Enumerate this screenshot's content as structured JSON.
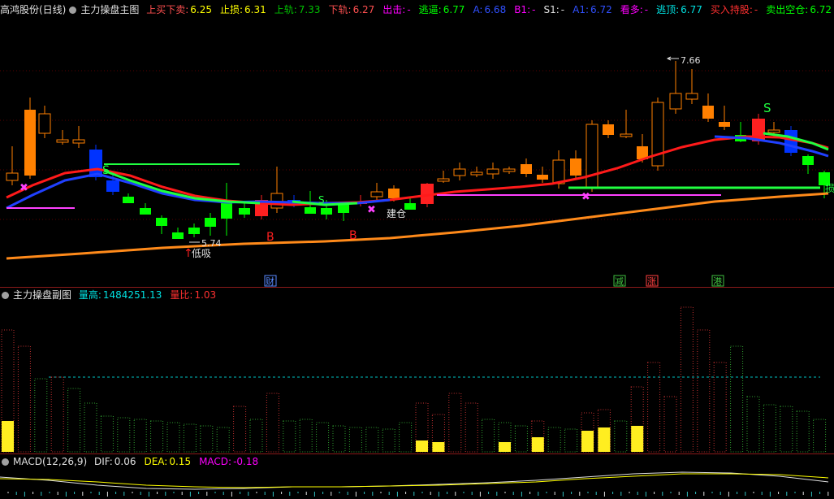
{
  "main": {
    "stock_title": "高鸿股份(日线)",
    "indicator_name": "主力操盘主图",
    "fields": [
      {
        "label": "上买下卖:",
        "value": "6.25",
        "lc": "#ff5050",
        "vc": "#ffff00"
      },
      {
        "label": "止损:",
        "value": "6.31",
        "lc": "#ffff00",
        "vc": "#ffff00"
      },
      {
        "label": "上轨:",
        "value": "7.33",
        "lc": "#00c000",
        "vc": "#00c000"
      },
      {
        "label": "下轨:",
        "value": "6.27",
        "lc": "#ff5050",
        "vc": "#ff5050"
      },
      {
        "label": "出击:",
        "value": "-",
        "lc": "#ff00ff",
        "vc": "#ff00ff"
      },
      {
        "label": "逃逼:",
        "value": "6.77",
        "lc": "#00ff00",
        "vc": "#00ff00"
      },
      {
        "label": "A:",
        "value": "6.68",
        "lc": "#3050ff",
        "vc": "#3050ff"
      },
      {
        "label": "B1:",
        "value": "-",
        "lc": "#ff00ff",
        "vc": "#ff00ff"
      },
      {
        "label": "S1:",
        "value": "-",
        "lc": "#e0e0e0",
        "vc": "#e0e0e0"
      },
      {
        "label": "A1:",
        "value": "6.72",
        "lc": "#3050ff",
        "vc": "#3050ff"
      },
      {
        "label": "看多:",
        "value": "-",
        "lc": "#ff00ff",
        "vc": "#ff00ff"
      },
      {
        "label": "逃顶:",
        "value": "6.77",
        "lc": "#00e0e0",
        "vc": "#00e0e0"
      },
      {
        "label": "买入持股:",
        "value": "-",
        "lc": "#ff3030",
        "vc": "#ff3030"
      },
      {
        "label": "卖出空仓:",
        "value": "6.72",
        "lc": "#00ff00",
        "vc": "#00ff00"
      }
    ],
    "annotations": {
      "high_price": "7.66",
      "low_price": "5.74",
      "low_buy": "低吸",
      "build_position": "建仓",
      "b_label": "B",
      "s_label": "S",
      "right_edge_label": "损"
    },
    "event_tags": [
      "财",
      "减",
      "涨",
      "港"
    ]
  },
  "sub": {
    "indicator_name": "主力操盘副图",
    "fields": [
      {
        "label": "量高:",
        "value": "1484251.13",
        "lc": "#00e0e0",
        "vc": "#00e0e0"
      },
      {
        "label": "量比:",
        "value": "1.03",
        "lc": "#ff3030",
        "vc": "#ff3030"
      }
    ]
  },
  "macd": {
    "indicator_name": "MACD(12,26,9)",
    "fields": [
      {
        "label": "DIF:",
        "value": "0.06",
        "lc": "#e0e0e0",
        "vc": "#e0e0e0"
      },
      {
        "label": "DEA:",
        "value": "0.15",
        "lc": "#ffff00",
        "vc": "#ffff00"
      },
      {
        "label": "MACD:",
        "value": "-0.18",
        "lc": "#ff00ff",
        "vc": "#ff00ff"
      }
    ]
  },
  "colors": {
    "background": "#000000",
    "separator": "#8b1a1a",
    "grid": "#5a0000",
    "up_candle": "#ff8000",
    "down_candle": "#00ff00",
    "blue_candle": "#0033ff",
    "red_candle": "#ff2020",
    "ma_red": "#ff1a1a",
    "ma_blue": "#2040ff",
    "ma_green": "#20ff40",
    "ma_orange": "#ff8a1a",
    "magenta": "#ff40ff",
    "vol_up": "#c03030",
    "vol_down": "#30a030",
    "vol_high": "#ffee20"
  }
}
